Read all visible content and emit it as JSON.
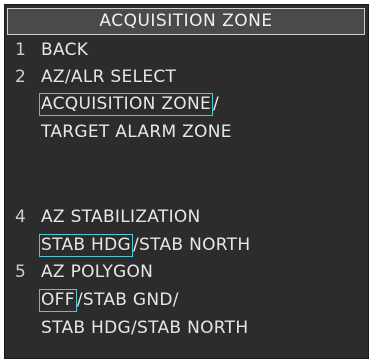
{
  "menu": {
    "title": "ACQUISITION ZONE",
    "items": [
      {
        "number": "1",
        "label": "BACK"
      },
      {
        "number": "2",
        "label": "AZ/ALR SELECT"
      },
      {
        "number": "4",
        "label": "AZ STABILIZATION"
      },
      {
        "number": "5",
        "label": "AZ POLYGON"
      }
    ],
    "az_alr_options": {
      "selected": "ACQUISITION ZONE",
      "separator": "/",
      "other": "TARGET ALARM ZONE"
    },
    "az_stab_options": {
      "selected": "STAB HDG",
      "separator": "/",
      "other": "STAB NORTH"
    },
    "az_polygon_options": {
      "selected": "OFF",
      "separator1": "/",
      "opt2": "STAB GND/",
      "line2": "STAB HDG/STAB NORTH"
    }
  },
  "colors": {
    "background": "#2c2c2c",
    "text": "#e6e6e6",
    "selection_border": "#4fc9cf"
  }
}
